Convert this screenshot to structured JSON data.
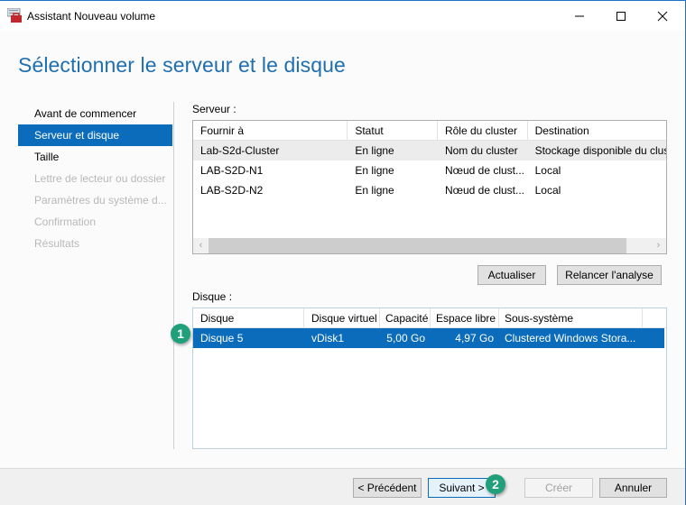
{
  "window": {
    "title": "Assistant Nouveau volume",
    "controls": {
      "minimize_icon": "minimize-icon",
      "maximize_icon": "maximize-icon",
      "close_icon": "close-icon"
    }
  },
  "page_title": "Sélectionner le serveur et le disque",
  "nav": {
    "items": [
      {
        "label": "Avant de commencer",
        "state": "normal"
      },
      {
        "label": "Serveur et disque",
        "state": "active"
      },
      {
        "label": "Taille",
        "state": "normal"
      },
      {
        "label": "Lettre de lecteur ou dossier",
        "state": "disabled"
      },
      {
        "label": "Paramètres du système d...",
        "state": "disabled"
      },
      {
        "label": "Confirmation",
        "state": "disabled"
      },
      {
        "label": "Résultats",
        "state": "disabled"
      }
    ]
  },
  "server": {
    "label": "Serveur :",
    "columns": [
      "Fournir à",
      "Statut",
      "Rôle du cluster",
      "Destination"
    ],
    "rows": [
      [
        "Lab-S2d-Cluster",
        "En ligne",
        "Nom du cluster",
        "Stockage disponible du clus"
      ],
      [
        "LAB-S2D-N1",
        "En ligne",
        "Nœud de clust...",
        "Local"
      ],
      [
        "LAB-S2D-N2",
        "En ligne",
        "Nœud de clust...",
        "Local"
      ]
    ],
    "scroll_left": "‹",
    "scroll_right": "›",
    "refresh_label": "Actualiser",
    "rescan_label": "Relancer l'analyse"
  },
  "disk": {
    "label": "Disque :",
    "columns": [
      "Disque",
      "Disque virtuel",
      "Capacité",
      "Espace libre",
      "Sous-système"
    ],
    "rows": [
      [
        "Disque 5",
        "vDisk1",
        "5,00 Go",
        "4,97 Go",
        "Clustered Windows Stora..."
      ]
    ]
  },
  "footer": {
    "previous_label": "< Précédent",
    "next_label": "Suivant >",
    "create_label": "Créer",
    "cancel_label": "Annuler"
  },
  "callouts": {
    "first": "1",
    "second": "2"
  },
  "colors": {
    "accent": "#0a6cbb",
    "title": "#1f6fb0",
    "callout": "#1fa07a"
  }
}
